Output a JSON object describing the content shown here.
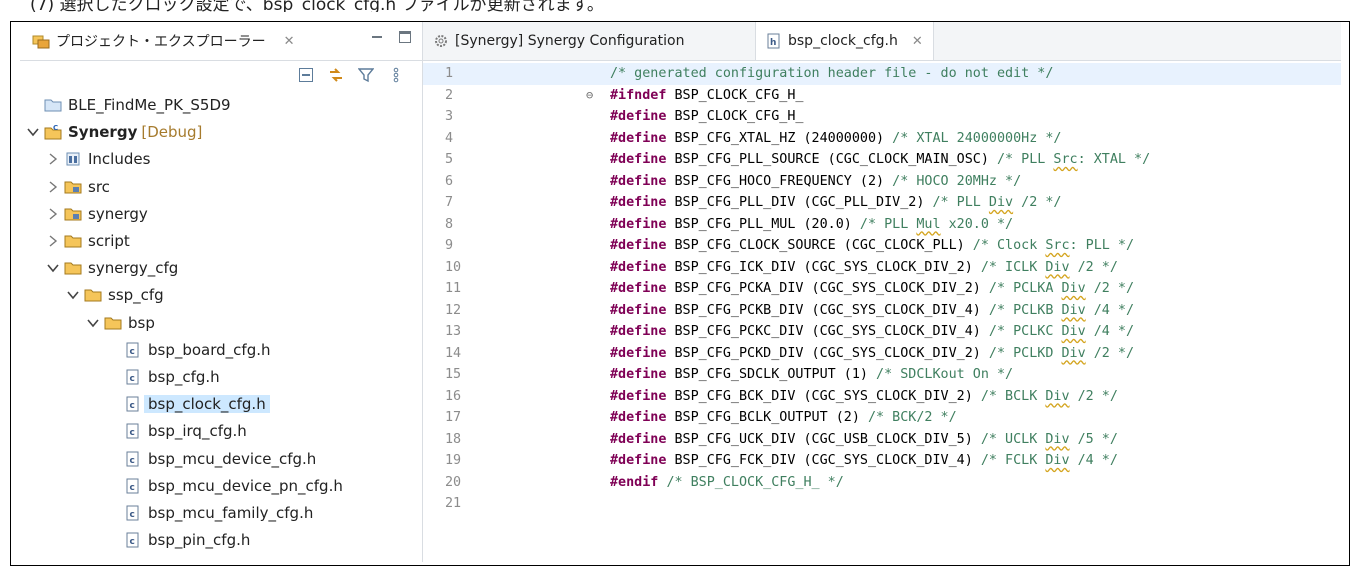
{
  "caption": "(7) 選択したクロック設定で、bsp_clock_cfg.h ファイルが更新されます。",
  "explorer": {
    "tab_label": "プロジェクト・エクスプローラー",
    "tab_close": "✕",
    "tree": [
      {
        "label": "BLE_FindMe_PK_S5D9",
        "indent": 0,
        "chevron": "none",
        "icon": "project-folder-icon"
      },
      {
        "label": "Synergy",
        "suffix": "[Debug]",
        "indent": 0,
        "chevron": "down",
        "icon": "c-project-icon",
        "bold": true
      },
      {
        "label": "Includes",
        "indent": 1,
        "chevron": "right",
        "icon": "includes-icon"
      },
      {
        "label": "src",
        "indent": 1,
        "chevron": "right",
        "icon": "source-folder-icon"
      },
      {
        "label": "synergy",
        "indent": 1,
        "chevron": "right",
        "icon": "source-folder-icon"
      },
      {
        "label": "script",
        "indent": 1,
        "chevron": "right",
        "icon": "folder-icon"
      },
      {
        "label": "synergy_cfg",
        "indent": 1,
        "chevron": "down",
        "icon": "folder-icon"
      },
      {
        "label": "ssp_cfg",
        "indent": 2,
        "chevron": "down",
        "icon": "folder-icon"
      },
      {
        "label": "bsp",
        "indent": 3,
        "chevron": "down",
        "icon": "folder-icon"
      },
      {
        "label": "bsp_board_cfg.h",
        "indent": 4,
        "chevron": "none",
        "icon": "header-file-icon"
      },
      {
        "label": "bsp_cfg.h",
        "indent": 4,
        "chevron": "none",
        "icon": "header-file-icon"
      },
      {
        "label": "bsp_clock_cfg.h",
        "indent": 4,
        "chevron": "none",
        "icon": "header-file-icon",
        "selected": true
      },
      {
        "label": "bsp_irq_cfg.h",
        "indent": 4,
        "chevron": "none",
        "icon": "header-file-icon"
      },
      {
        "label": "bsp_mcu_device_cfg.h",
        "indent": 4,
        "chevron": "none",
        "icon": "header-file-icon"
      },
      {
        "label": "bsp_mcu_device_pn_cfg.h",
        "indent": 4,
        "chevron": "none",
        "icon": "header-file-icon"
      },
      {
        "label": "bsp_mcu_family_cfg.h",
        "indent": 4,
        "chevron": "none",
        "icon": "header-file-icon"
      },
      {
        "label": "bsp_pin_cfg.h",
        "indent": 4,
        "chevron": "none",
        "icon": "header-file-icon"
      }
    ]
  },
  "editor": {
    "tabs": [
      {
        "label": "[Synergy] Synergy Configuration",
        "icon": "gear-icon",
        "active": false
      },
      {
        "label": "bsp_clock_cfg.h",
        "icon": "header-file-icon",
        "active": true,
        "close": "✕"
      }
    ],
    "current_line": 1,
    "lines": [
      {
        "n": "1",
        "fold": "",
        "text": "/* generated configuration header file - do not edit */"
      },
      {
        "n": "2",
        "fold": "⊖",
        "text": "#ifndef BSP_CLOCK_CFG_H_"
      },
      {
        "n": "3",
        "fold": "",
        "text": "#define BSP_CLOCK_CFG_H_"
      },
      {
        "n": "4",
        "fold": "",
        "text": "#define BSP_CFG_XTAL_HZ (24000000) /* XTAL 24000000Hz */"
      },
      {
        "n": "5",
        "fold": "",
        "text": "#define BSP_CFG_PLL_SOURCE (CGC_CLOCK_MAIN_OSC) /* PLL Src: XTAL */"
      },
      {
        "n": "6",
        "fold": "",
        "text": "#define BSP_CFG_HOCO_FREQUENCY (2) /* HOCO 20MHz */"
      },
      {
        "n": "7",
        "fold": "",
        "text": "#define BSP_CFG_PLL_DIV (CGC_PLL_DIV_2) /* PLL Div /2 */"
      },
      {
        "n": "8",
        "fold": "",
        "text": "#define BSP_CFG_PLL_MUL (20.0) /* PLL Mul x20.0 */"
      },
      {
        "n": "9",
        "fold": "",
        "text": "#define BSP_CFG_CLOCK_SOURCE (CGC_CLOCK_PLL) /* Clock Src: PLL */"
      },
      {
        "n": "10",
        "fold": "",
        "text": "#define BSP_CFG_ICK_DIV (CGC_SYS_CLOCK_DIV_2) /* ICLK Div /2 */"
      },
      {
        "n": "11",
        "fold": "",
        "text": "#define BSP_CFG_PCKA_DIV (CGC_SYS_CLOCK_DIV_2) /* PCLKA Div /2 */"
      },
      {
        "n": "12",
        "fold": "",
        "text": "#define BSP_CFG_PCKB_DIV (CGC_SYS_CLOCK_DIV_4) /* PCLKB Div /4 */"
      },
      {
        "n": "13",
        "fold": "",
        "text": "#define BSP_CFG_PCKC_DIV (CGC_SYS_CLOCK_DIV_4) /* PCLKC Div /4 */"
      },
      {
        "n": "14",
        "fold": "",
        "text": "#define BSP_CFG_PCKD_DIV (CGC_SYS_CLOCK_DIV_2) /* PCLKD Div /2 */"
      },
      {
        "n": "15",
        "fold": "",
        "text": "#define BSP_CFG_SDCLK_OUTPUT (1) /* SDCLKout On */"
      },
      {
        "n": "16",
        "fold": "",
        "text": "#define BSP_CFG_BCK_DIV (CGC_SYS_CLOCK_DIV_2) /* BCLK Div /2 */"
      },
      {
        "n": "17",
        "fold": "",
        "text": "#define BSP_CFG_BCLK_OUTPUT (2) /* BCK/2 */"
      },
      {
        "n": "18",
        "fold": "",
        "text": "#define BSP_CFG_UCK_DIV (CGC_USB_CLOCK_DIV_5) /* UCLK Div /5 */"
      },
      {
        "n": "19",
        "fold": "",
        "text": "#define BSP_CFG_FCK_DIV (CGC_SYS_CLOCK_DIV_4) /* FCLK Div /4 */"
      },
      {
        "n": "20",
        "fold": "",
        "text": "#endif /* BSP_CLOCK_CFG_H_ */"
      },
      {
        "n": "21",
        "fold": "",
        "text": ""
      }
    ]
  }
}
